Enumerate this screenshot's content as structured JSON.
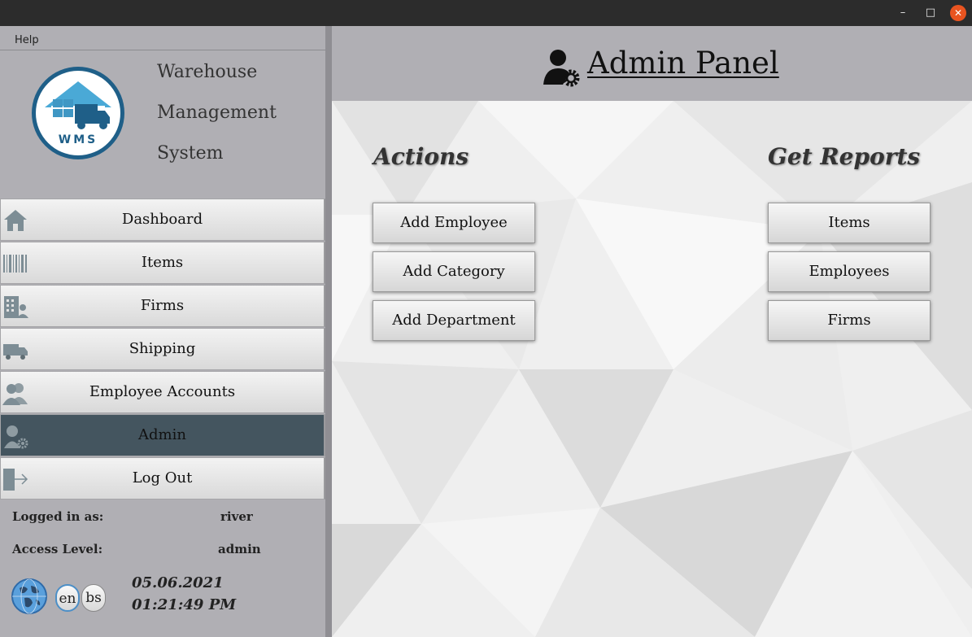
{
  "window": {
    "controls": {
      "minimize": "–",
      "maximize": "□",
      "close": "✕"
    }
  },
  "menu": {
    "help": "Help"
  },
  "brand": {
    "line1": "Warehouse",
    "line2": "Management",
    "line3": "System",
    "logo_text": "WMS"
  },
  "nav": [
    {
      "label": "Dashboard",
      "icon": "home-icon"
    },
    {
      "label": "Items",
      "icon": "barcode-icon"
    },
    {
      "label": "Firms",
      "icon": "building-icon"
    },
    {
      "label": "Shipping",
      "icon": "truck-icon"
    },
    {
      "label": "Employee Accounts",
      "icon": "users-icon"
    },
    {
      "label": "Admin",
      "icon": "admin-icon",
      "active": true
    },
    {
      "label": "Log Out",
      "icon": "logout-icon"
    }
  ],
  "session": {
    "logged_in_label": "Logged in as:",
    "user": "river",
    "access_label": "Access Level:",
    "level": "admin",
    "date": "05.06.2021",
    "time": "01:21:49 PM"
  },
  "languages": [
    "en",
    "bs"
  ],
  "main": {
    "title": "Admin Panel",
    "actions_title": "Actions",
    "reports_title": "Get Reports",
    "actions": [
      "Add Employee",
      "Add Category",
      "Add Department"
    ],
    "reports": [
      "Items",
      "Employees",
      "Firms"
    ]
  },
  "colors": {
    "active_nav": "#44555f",
    "sidebar_bg": "#b0afb4",
    "logo_blue": "#1f5f88",
    "title_bar": "#2c2c2c",
    "close_button": "#e95420"
  }
}
